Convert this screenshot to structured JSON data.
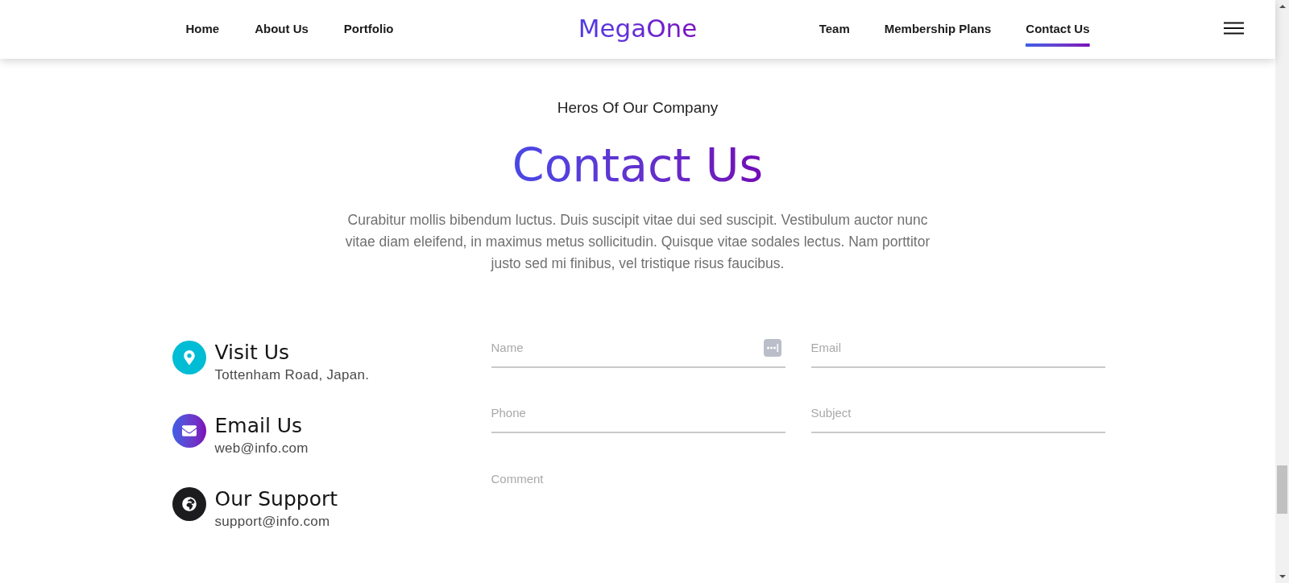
{
  "nav": {
    "links_left": [
      {
        "label": "Home",
        "selected": false
      },
      {
        "label": "About Us",
        "selected": false
      },
      {
        "label": "Portfolio",
        "selected": false
      }
    ],
    "logo": "MegaOne",
    "links_right": [
      {
        "label": "Team",
        "selected": false
      },
      {
        "label": "Membership Plans",
        "selected": false
      },
      {
        "label": "Contact Us",
        "selected": true
      }
    ]
  },
  "header": {
    "eyebrow": "Heros Of Our Company",
    "title": "Contact Us",
    "description": "Curabitur mollis bibendum luctus. Duis suscipit vitae dui sed suscipit. Vestibulum auctor nunc vitae diam eleifend, in maximus metus sollicitudin. Quisque vitae sodales lectus. Nam porttitor justo sed mi finibus, vel tristique risus faucibus."
  },
  "contact_items": [
    {
      "kind": "location",
      "title": "Visit Us",
      "detail": "Tottenham Road, Japan."
    },
    {
      "kind": "email",
      "title": "Email Us",
      "detail": "web@info.com"
    },
    {
      "kind": "support",
      "title": "Our Support",
      "detail": "support@info.com"
    }
  ],
  "form": {
    "fields": [
      {
        "kind": "input",
        "placeholder": "Name",
        "autofill_icon": true
      },
      {
        "kind": "input",
        "placeholder": "Email"
      },
      {
        "kind": "input",
        "placeholder": "Phone"
      },
      {
        "kind": "input",
        "placeholder": "Subject"
      },
      {
        "kind": "textarea",
        "placeholder": "Comment"
      }
    ]
  }
}
